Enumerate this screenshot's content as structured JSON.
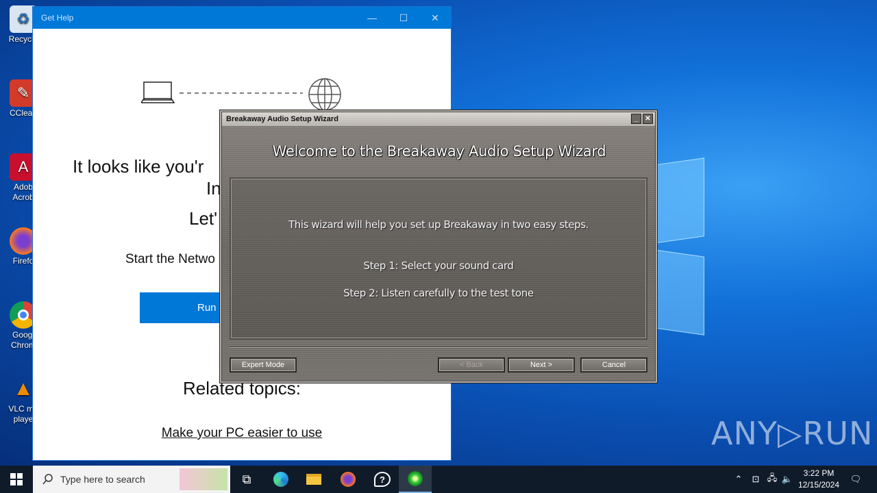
{
  "desktop": {
    "icons": [
      {
        "label": "Recycle",
        "icon": "recycle-bin-icon"
      },
      {
        "label": "CClean",
        "icon": "ccleaner-icon"
      },
      {
        "label": "Adob Acrob",
        "icon": "acrobat-icon"
      },
      {
        "label": "Firefo",
        "icon": "firefox-icon"
      },
      {
        "label": "Googl Chrom",
        "icon": "chrome-icon"
      },
      {
        "label": "VLC me playe",
        "icon": "vlc-icon"
      }
    ],
    "watermark": "ANY▷RUN"
  },
  "get_help": {
    "title": "Get Help",
    "heading": "It looks like you'r",
    "heading_line2": "In",
    "heading_line3": "Let'",
    "start_text": "Start the Netwo",
    "run_button": "Run",
    "related_topics": "Related topics:",
    "link": "Make your PC easier to use"
  },
  "wizard": {
    "window_title": "Breakaway Audio Setup Wizard",
    "title": "Welcome to the Breakaway Audio Setup Wizard",
    "intro": "This wizard will help you set up Breakaway in two easy steps.",
    "step1": "Step 1: Select your sound card",
    "step2": "Step 2: Listen carefully to the test tone",
    "buttons": {
      "expert": "Expert Mode",
      "back": "< Back",
      "next": "Next >",
      "cancel": "Cancel"
    }
  },
  "taskbar": {
    "search_placeholder": "Type here to search",
    "time": "3:22 PM",
    "date": "12/15/2024"
  }
}
